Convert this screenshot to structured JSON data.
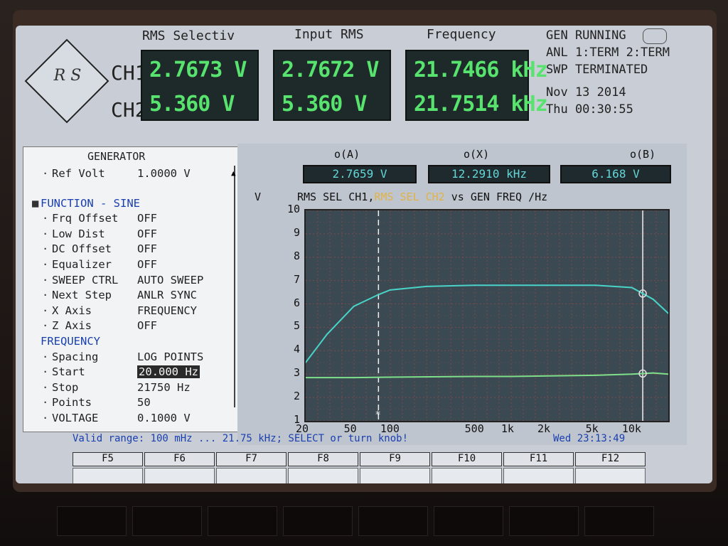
{
  "header": {
    "logo_text": "R S",
    "col_titles": [
      "RMS Selectiv",
      "Input RMS",
      "Frequency"
    ],
    "channels": [
      "CH1",
      "CH2"
    ],
    "rms_selective": [
      "2.7673  V",
      "5.360  V"
    ],
    "input_rms": [
      "2.7672  V",
      "5.360  V"
    ],
    "frequency": [
      "21.7466 kHz",
      "21.7514 kHz"
    ],
    "status_lines": [
      "GEN RUNNING",
      "ANL  1:TERM 2:TERM",
      "SWP TERMINATED",
      "Nov 13 2014",
      "Thu 00:30:55"
    ]
  },
  "generator": {
    "title": "GENERATOR",
    "rows": [
      {
        "k": "Ref Volt",
        "v": "1.0000 V",
        "style": "normal"
      },
      {
        "k": "FUNCTION - SINE",
        "v": "",
        "style": "blue-head"
      },
      {
        "k": "Frq Offset",
        "v": "OFF",
        "style": "normal"
      },
      {
        "k": "Low Dist",
        "v": "OFF",
        "style": "normal"
      },
      {
        "k": "DC Offset",
        "v": "OFF",
        "style": "normal"
      },
      {
        "k": "Equalizer",
        "v": "OFF",
        "style": "normal"
      },
      {
        "k": "SWEEP CTRL",
        "v": "AUTO SWEEP",
        "style": "normal"
      },
      {
        "k": "Next Step",
        "v": "ANLR SYNC",
        "style": "normal"
      },
      {
        "k": "X Axis",
        "v": "FREQUENCY",
        "style": "normal"
      },
      {
        "k": "Z Axis",
        "v": "OFF",
        "style": "normal"
      },
      {
        "k": "FREQUENCY",
        "v": "",
        "style": "blue-section"
      },
      {
        "k": "Spacing",
        "v": "LOG POINTS",
        "style": "normal"
      },
      {
        "k": "Start",
        "v": "20.000 Hz",
        "style": "selected"
      },
      {
        "k": "Stop",
        "v": "21750  Hz",
        "style": "normal"
      },
      {
        "k": "Points",
        "v": "50",
        "style": "normal"
      },
      {
        "k": "VOLTAGE",
        "v": "0.1000 V",
        "style": "normal"
      }
    ]
  },
  "graph": {
    "markers": [
      {
        "label": "o(A)",
        "value": "2.7659  V"
      },
      {
        "label": "o(X)",
        "value": "12.2910 kHz"
      },
      {
        "label": "o(B)",
        "value": "6.168  V"
      }
    ],
    "title_parts": [
      {
        "text": "RMS SEL  CH1,",
        "color": "#111111"
      },
      {
        "text": "RMS SEL  CH2",
        "color": "#e0b34a"
      },
      {
        "text": " vs    GEN FREQ /Hz",
        "color": "#111111"
      }
    ],
    "y_unit": "V",
    "colors": {
      "grid": "#8a4a4a",
      "ch1": "#48d4c8",
      "ch2": "#7ee08a",
      "bg": "#3b4a52"
    }
  },
  "chart_data": {
    "type": "line",
    "title": "RMS SEL  CH1, RMS SEL  CH2 vs GEN FREQ /Hz",
    "ylabel": "V",
    "xlabel": "",
    "x_scale": "log",
    "xlim": [
      20,
      20000
    ],
    "ylim": [
      1,
      10
    ],
    "y_ticks": [
      1,
      2,
      3,
      4,
      5,
      6,
      7,
      8,
      9,
      10
    ],
    "x_ticks": [
      {
        "value": 20,
        "label": "20"
      },
      {
        "value": 50,
        "label": "50"
      },
      {
        "value": 100,
        "label": "100"
      },
      {
        "value": 500,
        "label": "500"
      },
      {
        "value": 1000,
        "label": "1k"
      },
      {
        "value": 2000,
        "label": "2k"
      },
      {
        "value": 5000,
        "label": "5k"
      },
      {
        "value": 10000,
        "label": "10k"
      }
    ],
    "series": [
      {
        "name": "RMS SEL  CH1",
        "color": "#48d4c8",
        "x": [
          20,
          30,
          50,
          80,
          100,
          200,
          500,
          1000,
          2000,
          5000,
          10000,
          15000,
          20000
        ],
        "y": [
          3.5,
          4.7,
          5.9,
          6.4,
          6.6,
          6.75,
          6.8,
          6.8,
          6.8,
          6.8,
          6.7,
          6.2,
          5.6
        ]
      },
      {
        "name": "RMS SEL  CH2",
        "color": "#7ee08a",
        "x": [
          20,
          50,
          100,
          500,
          1000,
          5000,
          10000,
          15000,
          20000
        ],
        "y": [
          2.85,
          2.85,
          2.87,
          2.9,
          2.9,
          2.95,
          3.0,
          3.05,
          3.0
        ]
      }
    ],
    "cursors": [
      {
        "x": 80,
        "style": "dashed"
      },
      {
        "x": 12291,
        "style": "solid"
      }
    ],
    "grid": true
  },
  "bottom": {
    "valid_text": "Valid range: 100 mHz ... 21.75 kHz; SELECT or turn knob!",
    "clock": "Wed 23:13:49",
    "fkeys": [
      "F5",
      "F6",
      "F7",
      "F8",
      "F9",
      "F10",
      "F11",
      "F12"
    ]
  }
}
